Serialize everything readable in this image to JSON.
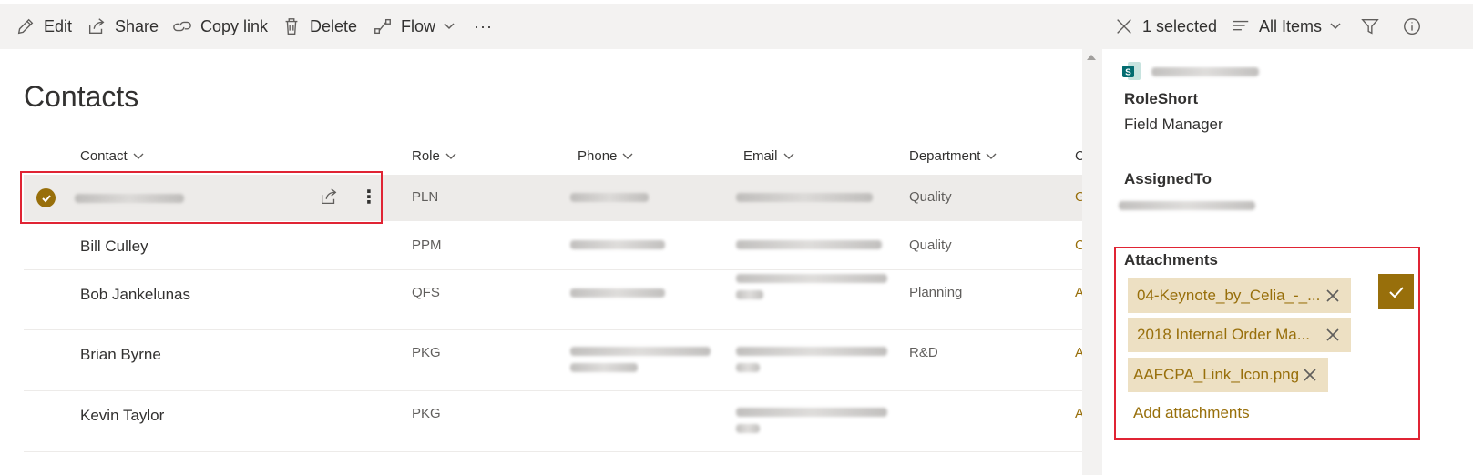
{
  "commandbar": {
    "edit": "Edit",
    "share": "Share",
    "copy_link": "Copy link",
    "delete": "Delete",
    "flow": "Flow",
    "more": "···",
    "selected": "1 selected",
    "view": "All Items"
  },
  "page": {
    "title": "Contacts"
  },
  "list": {
    "columns": [
      "Contact",
      "Role",
      "Phone",
      "Email",
      "Department",
      "C"
    ],
    "rows": [
      {
        "contact": "",
        "role": "PLN",
        "department": "Quality",
        "extra": "G",
        "selected": true
      },
      {
        "contact": "Bill Culley",
        "role": "PPM",
        "department": "Quality",
        "extra": "C",
        "selected": false
      },
      {
        "contact": "Bob Jankelunas",
        "role": "QFS",
        "department": "Planning",
        "extra": "A",
        "selected": false
      },
      {
        "contact": "Brian Byrne",
        "role": "PKG",
        "department": "R&D",
        "extra": "A",
        "selected": false
      },
      {
        "contact": "Kevin Taylor",
        "role": "PKG",
        "department": "",
        "extra": "A",
        "selected": false
      }
    ]
  },
  "pane": {
    "role_short_label": "RoleShort",
    "role_short_value": "Field Manager",
    "assigned_to_label": "AssignedTo",
    "attachments_label": "Attachments",
    "attachments": [
      "04-Keynote_by_Celia_-_...",
      "2018 Internal Order Ma...",
      "AAFCPA_Link_Icon.png"
    ],
    "add_attachments": "Add attachments"
  },
  "colors": {
    "accent": "#986f0b",
    "chip_bg": "#ede0c3",
    "highlight_border": "#e02434",
    "commandbar_bg": "#f3f2f1"
  }
}
